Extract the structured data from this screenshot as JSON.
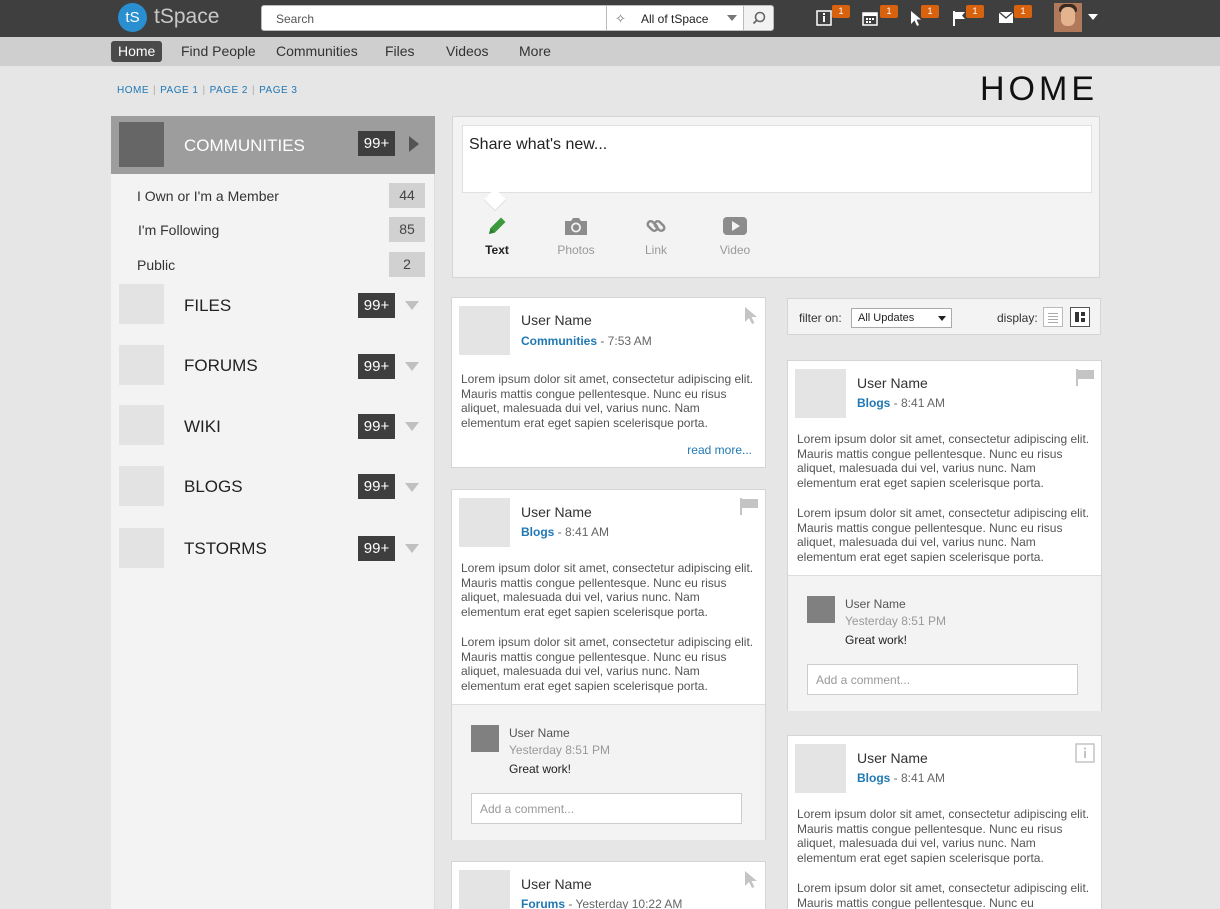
{
  "app": {
    "logo_mark": "tS",
    "name": "tSpace"
  },
  "search": {
    "placeholder": "Search",
    "scope": "All of tSpace",
    "scope_icon": "people-scope-icon",
    "button_icon": "search-icon"
  },
  "toolbar": {
    "badges": [
      {
        "icon": "info-icon",
        "count": "1"
      },
      {
        "icon": "calendar-icon",
        "count": "1"
      },
      {
        "icon": "cursor-icon",
        "count": "1"
      },
      {
        "icon": "flag-icon",
        "count": "1"
      },
      {
        "icon": "mail-icon",
        "count": "1"
      }
    ],
    "badge_color": "#d9620f"
  },
  "nav": {
    "items": [
      "Home",
      "Find People",
      "Communities",
      "Files",
      "Videos",
      "More"
    ],
    "active": "Home"
  },
  "breadcrumb": [
    "HOME",
    "PAGE 1",
    "PAGE 2",
    "PAGE 3"
  ],
  "page_title": "HOME",
  "sidebar": {
    "communities": {
      "title": "COMMUNITIES",
      "count": "99+",
      "sub_items": [
        {
          "label": "I Own or I'm a Member",
          "count": "44"
        },
        {
          "label": "I'm Following",
          "count": "85"
        },
        {
          "label": "Public",
          "count": "2"
        }
      ]
    },
    "sections": [
      {
        "title": "FILES",
        "count": "99+"
      },
      {
        "title": "FORUMS",
        "count": "99+"
      },
      {
        "title": "WIKI",
        "count": "99+"
      },
      {
        "title": "BLOGS",
        "count": "99+"
      },
      {
        "title": "TSTORMS",
        "count": "99+"
      }
    ]
  },
  "share": {
    "placeholder": "Share what's new...",
    "options": [
      {
        "label": "Text",
        "icon": "pencil-icon"
      },
      {
        "label": "Photos",
        "icon": "camera-icon"
      },
      {
        "label": "Link",
        "icon": "link-icon"
      },
      {
        "label": "Video",
        "icon": "video-icon"
      }
    ]
  },
  "filter": {
    "label": "filter on:",
    "value": "All Updates",
    "display_label": "display:"
  },
  "posts": {
    "p1": {
      "user": "User Name",
      "source": "Communities",
      "time": " - 7:53 AM",
      "body": "Lorem ipsum dolor sit amet, consectetur adipiscing elit. Mauris mattis congue pellentesque. Nunc eu risus aliquet, malesuada dui vel, varius nunc. Nam elementum erat eget sapien scelerisque porta.",
      "read_more": "read more...",
      "icon": "cursor-icon"
    },
    "p2": {
      "user": "User Name",
      "source": "Blogs",
      "time": " - 8:41 AM",
      "body1": "Lorem ipsum dolor sit amet, consectetur adipiscing elit. Mauris mattis congue pellentesque. Nunc eu risus aliquet, malesuada dui vel, varius nunc. Nam elementum erat eget sapien scelerisque porta.",
      "body2": "Lorem ipsum dolor sit amet, consectetur adipiscing elit. Mauris mattis congue pellentesque. Nunc eu risus aliquet, malesuada dui vel, varius nunc. Nam elementum erat eget sapien scelerisque porta.",
      "comment": {
        "user": "User Name",
        "time": "Yesterday 8:51 PM",
        "text": "Great work!"
      },
      "comment_placeholder": "Add a comment...",
      "icon": "flag-icon"
    },
    "p3": {
      "user": "User Name",
      "source": "Forums",
      "time": " - Yesterday 10:22 AM",
      "icon": "cursor-icon"
    },
    "r1": {
      "user": "User Name",
      "source": "Blogs",
      "time": " - 8:41 AM",
      "body1": "Lorem ipsum dolor sit amet, consectetur adipiscing elit. Mauris mattis congue pellentesque. Nunc eu risus aliquet, malesuada dui vel, varius nunc. Nam elementum erat eget sapien scelerisque porta.",
      "body2": "Lorem ipsum dolor sit amet, consectetur adipiscing elit. Mauris mattis congue pellentesque. Nunc eu risus aliquet, malesuada dui vel, varius nunc. Nam elementum erat eget sapien scelerisque porta.",
      "comment": {
        "user": "User Name",
        "time": "Yesterday 8:51 PM",
        "text": "Great work!"
      },
      "comment_placeholder": "Add a comment...",
      "icon": "flag-icon"
    },
    "r2": {
      "user": "User Name",
      "source": "Blogs",
      "time": " - 8:41 AM",
      "body1": "Lorem ipsum dolor sit amet, consectetur adipiscing elit. Mauris mattis congue pellentesque. Nunc eu risus aliquet, malesuada dui vel, varius nunc. Nam elementum erat eget sapien scelerisque porta.",
      "body2": "Lorem ipsum dolor sit amet, consectetur adipiscing elit. Mauris mattis congue pellentesque. Nunc eu",
      "icon": "info-icon"
    }
  }
}
